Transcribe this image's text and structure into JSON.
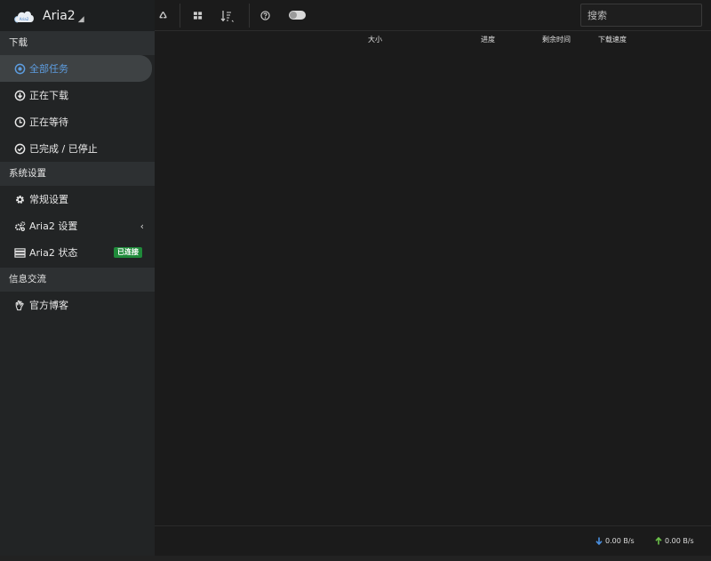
{
  "app": {
    "name": "Aria2",
    "logo_text": "Aria2"
  },
  "sidebar": {
    "sections": [
      {
        "title": "下载"
      },
      {
        "title": "系统设置"
      },
      {
        "title": "信息交流"
      }
    ],
    "items": [
      {
        "label": "全部任务",
        "icon": "dot-circle-icon",
        "active": true
      },
      {
        "label": "正在下载",
        "icon": "download-circle-icon"
      },
      {
        "label": "正在等待",
        "icon": "clock-icon"
      },
      {
        "label": "已完成 / 已停止",
        "icon": "check-circle-icon"
      },
      {
        "label": "常规设置",
        "icon": "gear-icon"
      },
      {
        "label": "Aria2 设置",
        "icon": "gears-icon"
      },
      {
        "label": "Aria2 状态",
        "icon": "server-icon",
        "badge": "已连接"
      },
      {
        "label": "官方博客",
        "icon": "hand-icon"
      }
    ]
  },
  "toolbar": {
    "buttons": [
      "recycle-icon",
      "grid-icon",
      "sort-icon",
      "help-icon",
      "theme-toggle"
    ]
  },
  "search": {
    "placeholder": "搜索"
  },
  "table": {
    "columns": [
      "大小",
      "进度",
      "剩余时间",
      "下载速度"
    ]
  },
  "footer": {
    "download_speed": "0.00 B/s",
    "upload_speed": "0.00 B/s"
  },
  "colors": {
    "accent": "#5d9de0",
    "badge": "#1f8a3a",
    "download_arrow": "#4a8fe0",
    "upload_arrow": "#6cc24a"
  }
}
